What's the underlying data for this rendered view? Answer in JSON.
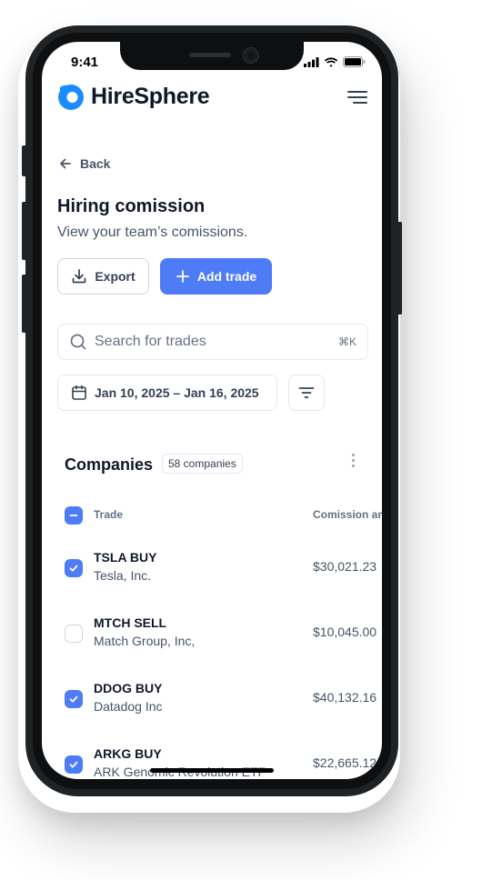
{
  "status_bar": {
    "time": "9:41"
  },
  "brand": {
    "name": "HireSphere",
    "accent": "#4d7cf6",
    "logo_color": "#1a8cff"
  },
  "nav": {
    "back_label": "Back",
    "menu_icon": "hamburger-menu-icon"
  },
  "header": {
    "title": "Hiring comission",
    "subtitle": "View your team’s comissions.",
    "export_label": "Export",
    "add_label": "Add trade"
  },
  "search": {
    "placeholder": "Search for trades",
    "shortcut": "⌘K"
  },
  "date_range": {
    "label": "Jan 10, 2025 – Jan 16, 2025"
  },
  "table": {
    "title": "Companies",
    "count": "58 companies",
    "columns": {
      "trade": "Trade",
      "commission": "Comission amount"
    },
    "header_checkbox": "indeterminate",
    "rows": [
      {
        "name": "TSLA BUY",
        "company": "Tesla, Inc.",
        "amount": "$30,021.23",
        "checked": true
      },
      {
        "name": "MTCH SELL",
        "company": "Match Group, Inc,",
        "amount": "$10,045.00",
        "checked": false
      },
      {
        "name": "DDOG BUY",
        "company": "Datadog Inc",
        "amount": "$40,132.16",
        "checked": true
      },
      {
        "name": "ARKG BUY",
        "company": "ARK Genomic Revolution ETF",
        "amount": "$22,665.12",
        "checked": true
      }
    ]
  }
}
